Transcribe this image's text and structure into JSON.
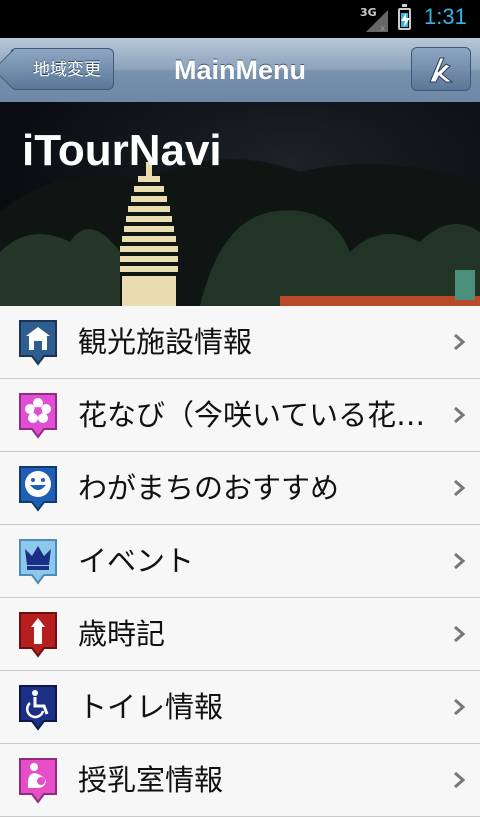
{
  "status_bar": {
    "network": "3G",
    "time": "1:31",
    "battery_level": 0.8,
    "icons": [
      "signal-icon",
      "battery-charging-icon"
    ]
  },
  "nav_bar": {
    "back_label": "地域変更",
    "title": "MainMenu",
    "logo_icon": "itournavi-logo-icon"
  },
  "hero": {
    "title": "iTourNavi"
  },
  "menu": {
    "items": [
      {
        "label": "観光施設情報",
        "icon": "facility-icon",
        "color": "#2f5d8f"
      },
      {
        "label": "花なび（今咲いている花…",
        "icon": "flower-icon",
        "color": "#e04ed4"
      },
      {
        "label": "わがまちのおすすめ",
        "icon": "smile-icon",
        "color": "#1e5fb5"
      },
      {
        "label": "イベント",
        "icon": "crown-icon",
        "color": "#8cc8ec"
      },
      {
        "label": "歳時記",
        "icon": "calendar-icon",
        "color": "#b51f1f"
      },
      {
        "label": "トイレ情報",
        "icon": "wheelchair-icon",
        "color": "#1a2f85"
      },
      {
        "label": "授乳室情報",
        "icon": "nursing-icon",
        "color": "#e64ec8"
      }
    ]
  },
  "colors": {
    "accent": "#33b5e5",
    "nav_bar": "#7891ad"
  }
}
